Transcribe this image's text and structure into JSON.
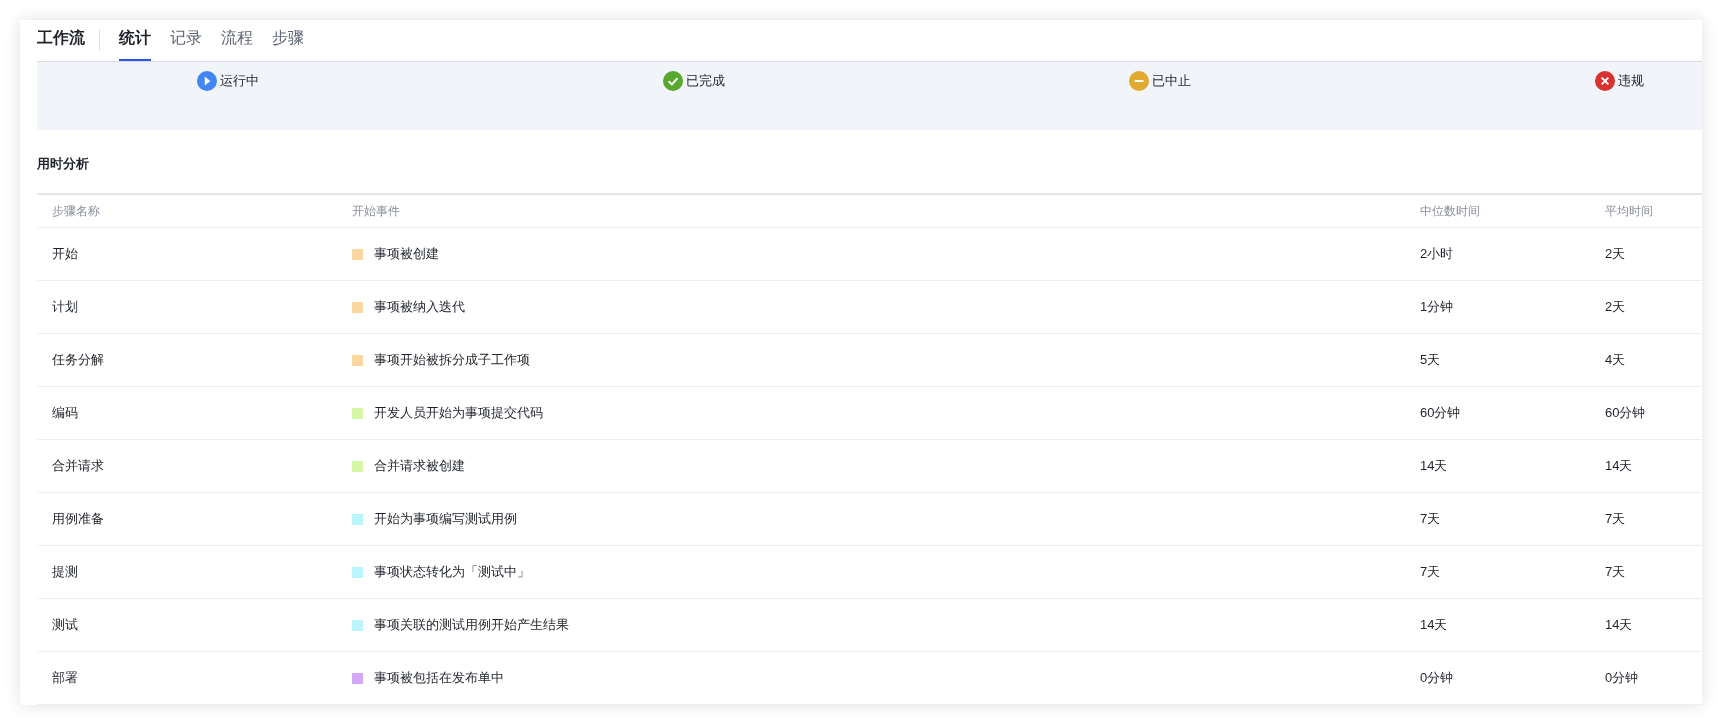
{
  "header": {
    "title": "工作流",
    "tabs": [
      {
        "label": "统计",
        "selected": true
      },
      {
        "label": "记录",
        "selected": false
      },
      {
        "label": "流程",
        "selected": false
      },
      {
        "label": "步骤",
        "selected": false
      }
    ]
  },
  "legend": [
    {
      "kind": "running",
      "label": "运行中",
      "color": "#4285f4"
    },
    {
      "kind": "done",
      "label": "已完成",
      "color": "#57a82d"
    },
    {
      "kind": "stopped",
      "label": "已中止",
      "color": "#e1a92f"
    },
    {
      "kind": "violation",
      "label": "违规",
      "color": "#d8312f"
    }
  ],
  "section_title": "用时分析",
  "table": {
    "columns": [
      "步骤名称",
      "开始事件",
      "中位数时间",
      "平均时间"
    ],
    "rows": [
      {
        "step": "开始",
        "event": "事项被创建",
        "color": "#fad7a0",
        "median": "2小时",
        "average": "2天"
      },
      {
        "step": "计划",
        "event": "事项被纳入迭代",
        "color": "#fad7a0",
        "median": "1分钟",
        "average": "2天"
      },
      {
        "step": "任务分解",
        "event": "事项开始被拆分成子工作项",
        "color": "#fad7a0",
        "median": "5天",
        "average": "4天"
      },
      {
        "step": "编码",
        "event": "开发人员开始为事项提交代码",
        "color": "#d5f7a5",
        "median": "60分钟",
        "average": "60分钟"
      },
      {
        "step": "合并请求",
        "event": "合并请求被创建",
        "color": "#d5f7a5",
        "median": "14天",
        "average": "14天"
      },
      {
        "step": "用例准备",
        "event": "开始为事项编写测试用例",
        "color": "#b9f5fa",
        "median": "7天",
        "average": "7天"
      },
      {
        "step": "提测",
        "event": "事项状态转化为「测试中」",
        "color": "#b9f5fa",
        "median": "7天",
        "average": "7天"
      },
      {
        "step": "测试",
        "event": "事项关联的测试用例开始产生结果",
        "color": "#b9f5fa",
        "median": "14天",
        "average": "14天"
      },
      {
        "step": "部署",
        "event": "事项被包括在发布单中",
        "color": "#d3a6f7",
        "median": "0分钟",
        "average": "0分钟"
      }
    ]
  }
}
